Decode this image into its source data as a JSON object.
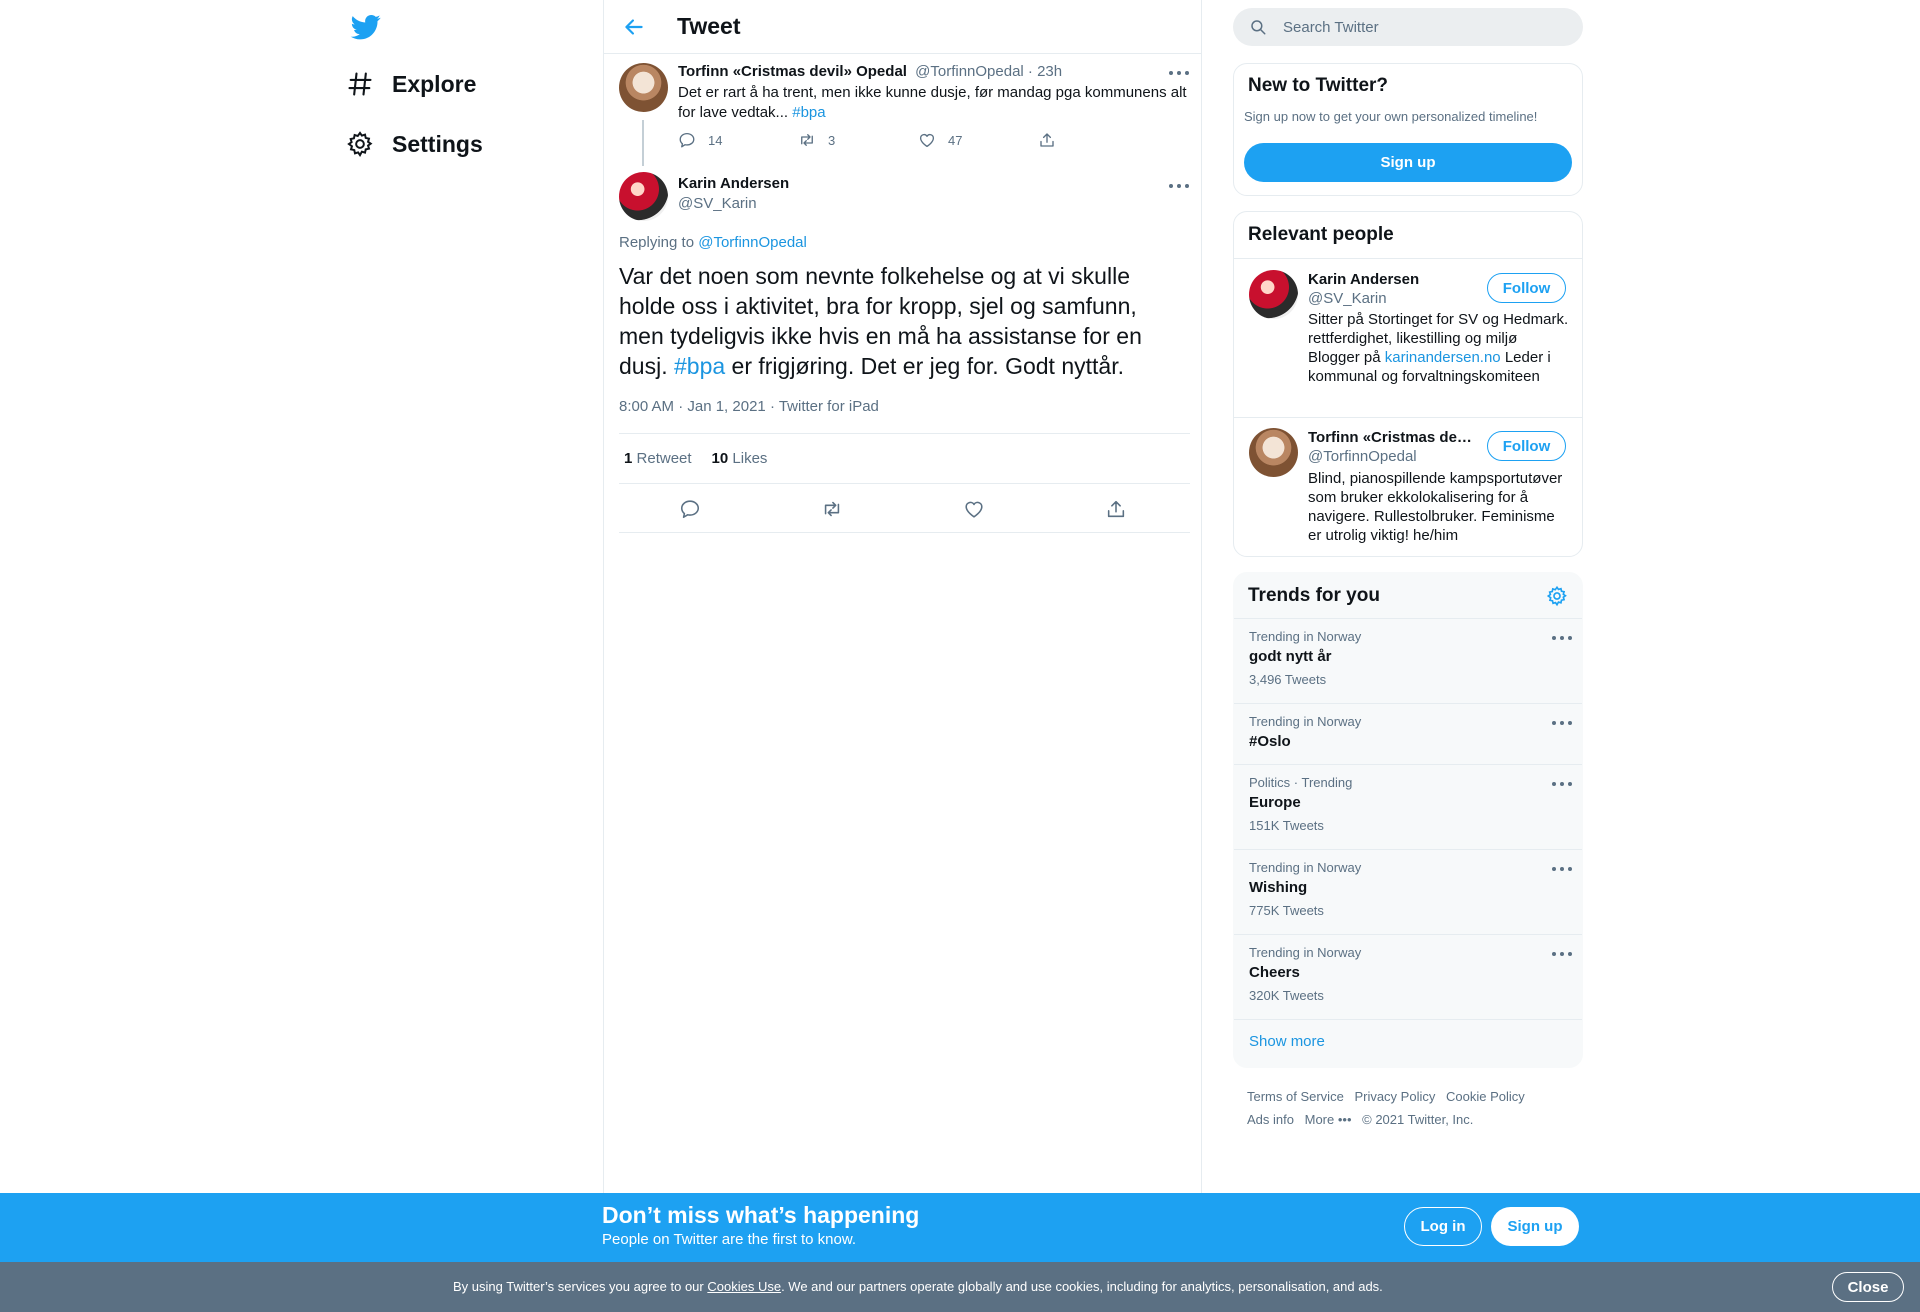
{
  "colors": {
    "accent": "#1da1f2",
    "link": "#1b95e0",
    "muted": "#5b7083",
    "banner_blue": "#1da1f2",
    "cookie_grey": "#5b7083"
  },
  "nav": {
    "logo": "twitter-bird-icon",
    "items": [
      {
        "label": "Explore",
        "icon": "hashtag-icon"
      },
      {
        "label": "Settings",
        "icon": "gear-icon"
      }
    ]
  },
  "header": {
    "title": "Tweet"
  },
  "parent_tweet": {
    "name": "Torfinn «Cristmas devil» Opedal",
    "handle": "@TorfinnOpedal",
    "time": "23h",
    "text": "Det er rart å ha trent, men ikke kunne dusje, før mandag pga kommunens alt for lave vedtak...",
    "hashtag": "#bpa",
    "replies": "14",
    "retweets": "3",
    "likes": "47"
  },
  "main_tweet": {
    "name": "Karin Andersen",
    "handle": "@SV_Karin",
    "replying_to_label": "Replying to",
    "replying_to_handle": "@TorfinnOpedal",
    "text_before": "Var det noen som nevnte folkehelse og at vi skulle holde oss i aktivitet, bra for kropp, sjel og samfunn, men tydeligvis ikke hvis en må ha assistanse for en dusj.",
    "hashtag": "#bpa",
    "text_after": "er frigjøring. Det er jeg for. Godt nyttår.",
    "time": "8:00 AM · Jan 1, 2021",
    "source": "Twitter for iPad",
    "retweet_count": "1",
    "retweet_label": "Retweet",
    "like_count": "10",
    "like_label": "Likes"
  },
  "search": {
    "placeholder": "Search Twitter"
  },
  "new_to_twitter": {
    "title": "New to Twitter?",
    "subtitle": "Sign up now to get your own personalized timeline!",
    "button": "Sign up"
  },
  "relevant_people": {
    "title": "Relevant people",
    "follow_label": "Follow",
    "people": [
      {
        "name": "Karin Andersen",
        "handle": "@SV_Karin",
        "bio_before": "Sitter på Stortinget for SV og Hedmark. rettferdighet, likestilling og miljø Blogger på",
        "bio_link": "karinandersen.no",
        "bio_after": "Leder i kommunal og forvaltningskomiteen"
      },
      {
        "name": "Torfinn «Cristmas devil» Opedal",
        "handle": "@TorfinnOpedal",
        "bio_before": "Blind, pianospillende kampsportutøver som bruker ekkolokalisering for å navigere. Rullestolbruker. Feminisme er utrolig viktig! he/him",
        "bio_link": "",
        "bio_after": ""
      }
    ]
  },
  "trends": {
    "title": "Trends for you",
    "items": [
      {
        "context": "Trending in Norway",
        "name": "godt nytt år",
        "count": "3,496 Tweets"
      },
      {
        "context": "Trending in Norway",
        "name": "#Oslo",
        "count": ""
      },
      {
        "context": "Politics · Trending",
        "name": "Europe",
        "count": "151K Tweets"
      },
      {
        "context": "Trending in Norway",
        "name": "Wishing",
        "count": "775K Tweets"
      },
      {
        "context": "Trending in Norway",
        "name": "Cheers",
        "count": "320K Tweets"
      }
    ],
    "show_more": "Show more"
  },
  "footer": {
    "links": [
      "Terms of Service",
      "Privacy Policy",
      "Cookie Policy",
      "Ads info",
      "More"
    ],
    "copyright": "© 2021 Twitter, Inc."
  },
  "banner": {
    "headline": "Don’t miss what’s happening",
    "subline": "People on Twitter are the first to know.",
    "login": "Log in",
    "signup": "Sign up"
  },
  "cookie_bar": {
    "text_before": "By using Twitter’s services you agree to our",
    "link": "Cookies Use",
    "text_after": ". We and our partners operate globally and use cookies, including for analytics, personalisation, and ads.",
    "close": "Close"
  }
}
